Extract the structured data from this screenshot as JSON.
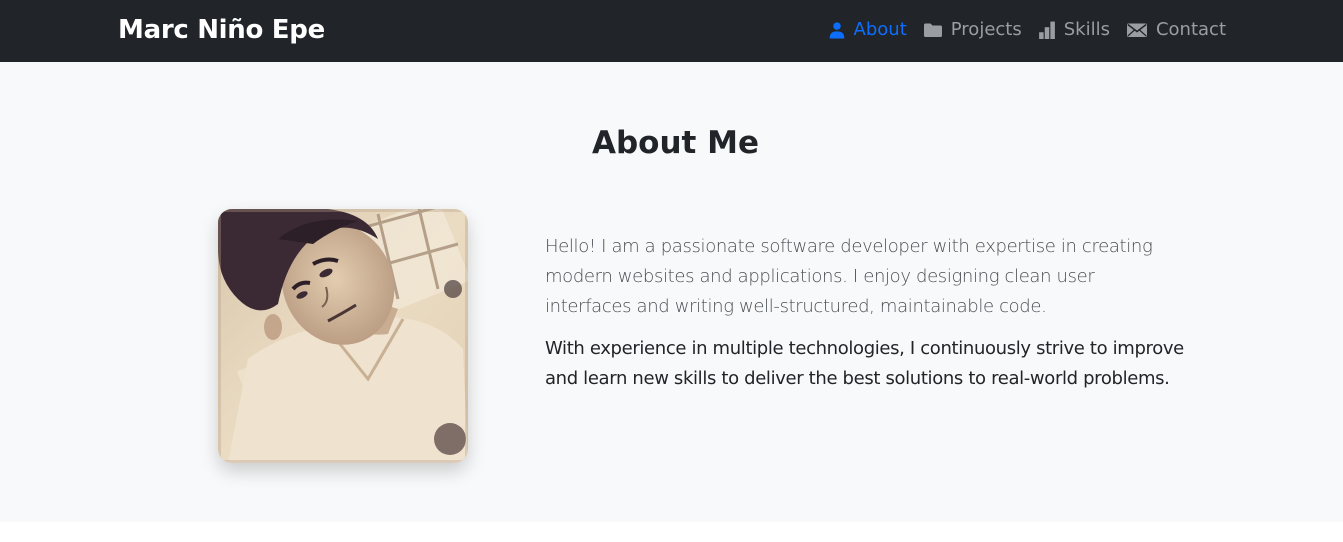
{
  "navbar": {
    "brand": "Marc Niño Epe",
    "items": [
      {
        "label": "About",
        "icon": "person-icon",
        "active": true
      },
      {
        "label": "Projects",
        "icon": "folder-icon",
        "active": false
      },
      {
        "label": "Skills",
        "icon": "bar-chart-icon",
        "active": false
      },
      {
        "label": "Contact",
        "icon": "envelope-icon",
        "active": false
      }
    ]
  },
  "about": {
    "title": "About Me",
    "lead": "Hello! I am a passionate software developer with expertise in creating modern websites and applications. I enjoy designing clean user interfaces and writing well-structured, maintainable code.",
    "paragraph": "With experience in multiple technologies, I continuously strive to improve and learn new skills to deliver the best solutions to real-world problems."
  },
  "colors": {
    "navbar_bg": "#212529",
    "nav_active": "#0d6efd",
    "nav_inactive": "#9a9da1",
    "section_bg": "#f8f9fa"
  }
}
